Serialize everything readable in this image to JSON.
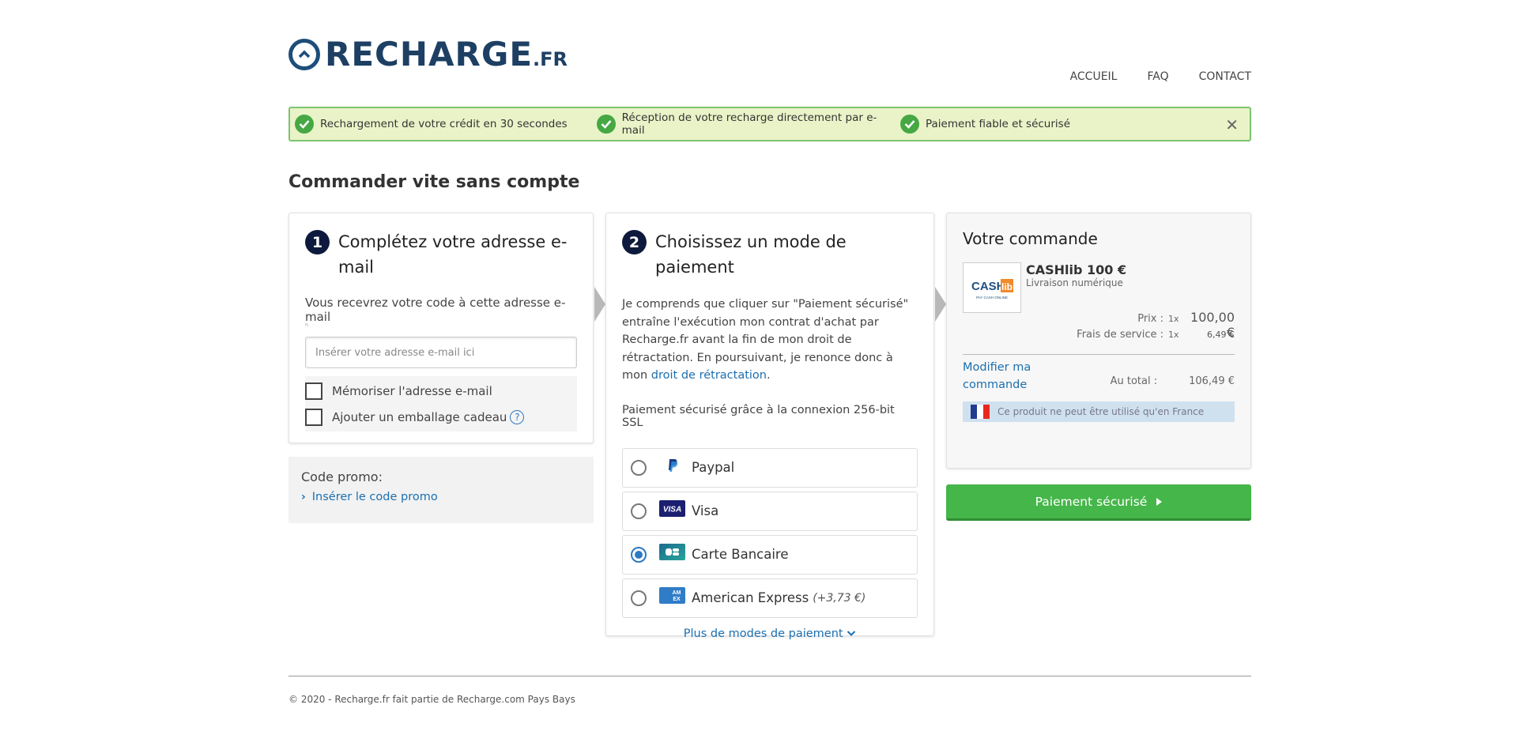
{
  "header": {
    "logo_main": "RECHARGE",
    "logo_tld": ".FR",
    "nav": [
      "ACCUEIL",
      "FAQ",
      "CONTACT"
    ]
  },
  "usp": {
    "items": [
      "Rechargement de votre crédit en 30 secondes",
      "Réception de votre recharge directement par e-mail",
      "Paiement fiable et sécurisé"
    ],
    "close": "✕"
  },
  "page_title": "Commander vite sans compte",
  "step1": {
    "number": "1",
    "title": "Complétez votre adresse e-mail",
    "hint": "Vous recevrez votre code à cette adresse e-mail",
    "hint_small": "ⁿ",
    "email_placeholder": "Insérer votre adresse e-mail ici",
    "remember_label": "Mémoriser l'adresse e-mail",
    "gift_label": "Ajouter un emballage cadeau",
    "help": "?"
  },
  "promo": {
    "label": "Code promo:",
    "link": "Insérer le code promo"
  },
  "step2": {
    "number": "2",
    "title": "Choisissez un mode de paiement",
    "legal_text": "Je comprends que cliquer sur \"Paiement sécurisé\" entraîne l'exécution mon contrat d'achat par Recharge.fr avant la fin de mon droit de rétractation. En poursuivant, je renonce donc à mon ",
    "legal_link": "droit de rétractation",
    "legal_end": ".",
    "ssl": "Paiement sécurisé grâce à la connexion 256-bit SSL",
    "methods": [
      {
        "label": "Paypal",
        "extra": ""
      },
      {
        "label": "Visa",
        "extra": ""
      },
      {
        "label": "Carte Bancaire",
        "extra": ""
      },
      {
        "label": "American Express",
        "extra": "(+3,73 €)"
      }
    ],
    "selected": "Carte Bancaire",
    "more": "Plus de modes de paiement"
  },
  "order": {
    "title": "Votre commande",
    "product_name": "CASHlib 100 €",
    "product_sub": "Livraison numérique",
    "price_label": "Prix :",
    "price_qty": "1x",
    "price_value": "100,00 €",
    "fee_label": "Frais de service :",
    "fee_qty": "1x",
    "fee_value": "6,49 €",
    "modify": "Modifier ma commande",
    "total_label": "Au total :",
    "total_value": "106,49 €",
    "france_note": "Ce produit ne peut être utilisé qu'en France",
    "thumb_text": "CASHlib",
    "thumb_sub": "PAY CASH ONLINE"
  },
  "pay_button": "Paiement sécurisé",
  "footer": "© 2020 - Recharge.fr fait partie de Recharge.com Pays Bays",
  "colors": {
    "brand": "#1d3f63",
    "green": "#45b649",
    "link": "#1c6fb0",
    "step": "#0e1a3d"
  }
}
